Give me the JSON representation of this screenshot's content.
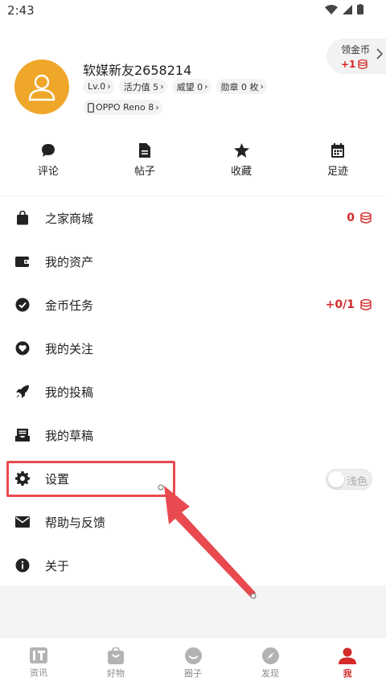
{
  "status": {
    "time": "2:43"
  },
  "coin_pill": {
    "title": "领金币",
    "amount": "+1"
  },
  "profile": {
    "username": "软媒新友2658214",
    "badges": [
      {
        "label": "Lv.0"
      },
      {
        "label": "活力值 5"
      },
      {
        "label": "威望 0"
      },
      {
        "label": "勋章 0 枚"
      }
    ],
    "device": "OPPO Reno 8"
  },
  "quick_actions": [
    {
      "label": "评论",
      "icon": "comment-icon"
    },
    {
      "label": "帖子",
      "icon": "document-icon"
    },
    {
      "label": "收藏",
      "icon": "star-icon"
    },
    {
      "label": "足迹",
      "icon": "calendar-icon"
    }
  ],
  "menu": [
    {
      "label": "之家商城",
      "value": "0",
      "icon": "shopping-bag-icon"
    },
    {
      "label": "我的资产",
      "value": "",
      "icon": "wallet-icon"
    },
    {
      "label": "金币任务",
      "value": "+0/1",
      "icon": "check-circle-icon"
    },
    {
      "label": "我的关注",
      "value": "",
      "icon": "heart-icon"
    },
    {
      "label": "我的投稿",
      "value": "",
      "icon": "rocket-icon"
    },
    {
      "label": "我的草稿",
      "value": "",
      "icon": "inbox-icon"
    },
    {
      "label": "设置",
      "toggle_label": "浅色",
      "icon": "gear-icon"
    },
    {
      "label": "帮助与反馈",
      "value": "",
      "icon": "mail-icon"
    },
    {
      "label": "关于",
      "value": "",
      "icon": "info-icon"
    }
  ],
  "bottom_nav": [
    {
      "label": "资讯",
      "icon": "it-news-icon",
      "active": false
    },
    {
      "label": "好物",
      "icon": "shopping-bag-icon",
      "active": false
    },
    {
      "label": "圈子",
      "icon": "smile-circle-icon",
      "active": false
    },
    {
      "label": "发现",
      "icon": "compass-icon",
      "active": false
    },
    {
      "label": "我",
      "icon": "person-icon",
      "active": true
    }
  ],
  "colors": {
    "accent": "#d42a2a",
    "avatar_bg": "#efa72a",
    "highlight": "#e84a4f"
  }
}
